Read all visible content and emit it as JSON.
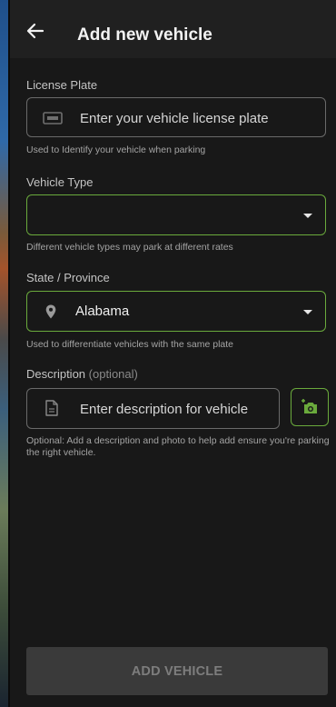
{
  "app_bar": {
    "title": "Add new vehicle"
  },
  "license_plate": {
    "label": "License Plate",
    "placeholder": "Enter your vehicle license plate",
    "helper": "Used to Identify your vehicle when parking",
    "icon": "license-plate-icon"
  },
  "vehicle_type": {
    "label": "Vehicle Type",
    "value": "",
    "helper": "Different vehicle types may park at different rates"
  },
  "state_province": {
    "label": "State / Province",
    "value": "Alabama",
    "helper": "Used to differentiate vehicles with the same plate",
    "icon": "location-pin-icon"
  },
  "description": {
    "label": "Description",
    "optional": "(optional)",
    "placeholder": "Enter description for vehicle",
    "helper": "Optional: Add a description and photo to help add ensure you're parking the right vehicle.",
    "icon": "document-icon",
    "camera_icon": "add-photo-icon"
  },
  "submit": {
    "label": "ADD VEHICLE",
    "enabled": false
  },
  "colors": {
    "accent": "#6aaa3c",
    "background": "#181818",
    "app_bar": "#202020",
    "disabled_button": "#3a3a3a"
  }
}
